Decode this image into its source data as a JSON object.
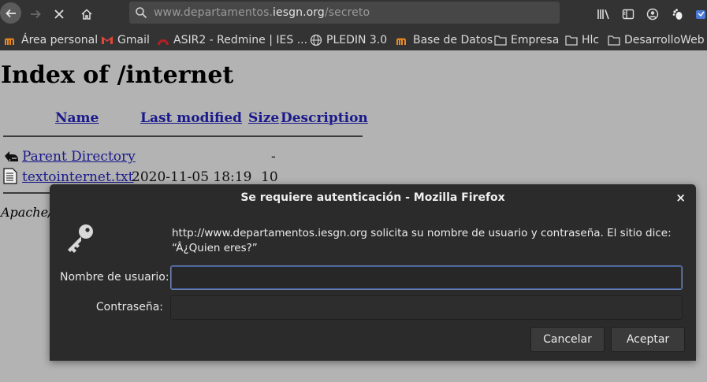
{
  "toolbar": {
    "url_prefix": "www.departamentos.",
    "url_host": "iesgn.org",
    "url_path": "/secreto"
  },
  "bookmarks": [
    {
      "label": "Área personal",
      "icon": "moodle-icon"
    },
    {
      "label": "Gmail",
      "icon": "gmail-icon"
    },
    {
      "label": "ASIR2 - Redmine | IES ...",
      "icon": "redmine-icon"
    },
    {
      "label": "PLEDIN 3.0",
      "icon": "globe-icon"
    },
    {
      "label": "Base de Datos",
      "icon": "moodle-icon"
    },
    {
      "label": "Empresa",
      "icon": "folder-icon"
    },
    {
      "label": "Hlc",
      "icon": "folder-icon"
    },
    {
      "label": "DesarrolloWeb",
      "icon": "folder-icon"
    }
  ],
  "page": {
    "title": "Index of /internet",
    "headers": {
      "name": "Name",
      "last_modified": "Last modified",
      "size": "Size",
      "description": "Description"
    },
    "rows": [
      {
        "name": "Parent Directory",
        "last_modified": "",
        "size": "-",
        "icon": "back-folder-icon"
      },
      {
        "name": "textointernet.txt",
        "last_modified": "2020-11-05 18:19",
        "size": "10",
        "icon": "text-file-icon"
      }
    ],
    "footer": "Apache/"
  },
  "dialog": {
    "title": "Se requiere autenticación - Mozilla Firefox",
    "close_label": "×",
    "message_line1": "http://www.departamentos.iesgn.org solicita su nombre de usuario y contraseña. El sitio dice:",
    "message_line2": "“Â¿Quien eres?”",
    "username_label": "Nombre de usuario:",
    "password_label": "Contraseña:",
    "username_value": "",
    "password_value": "",
    "cancel_label": "Cancelar",
    "accept_label": "Aceptar"
  },
  "colors": {
    "toolbar_bg": "#333333",
    "page_bg": "#b3b3b3",
    "dialog_bg": "#2b2b2b",
    "link": "#1a1a8c",
    "focus_border": "#6f83b0"
  }
}
